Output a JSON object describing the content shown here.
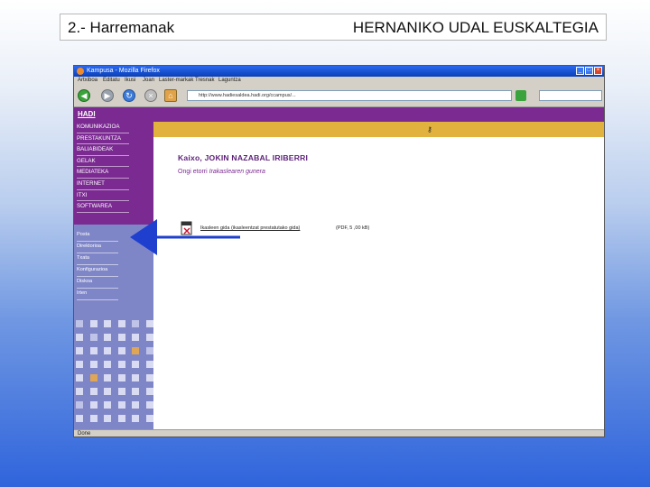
{
  "slide": {
    "title_left": "2.- Harremanak",
    "title_right": "HERNANIKO UDAL EUSKALTEGIA"
  },
  "browser": {
    "window_title": "Kampusa - Mozilla Firefox",
    "menu": [
      "Artxiboa",
      "Editatu",
      "Ikusi",
      "Joan",
      "Laster-markak",
      "Tresnak",
      "Laguntza"
    ],
    "url": "http://www.hadiesaldea.hadi.org/ccampus/...",
    "search_value": "",
    "status": "Done"
  },
  "sidebar": {
    "logo": "HADI",
    "menu": [
      "KOMUNIKAZIOA",
      "PRESTAKUNTZA",
      "BALIABIDEAK",
      "GELAK",
      "MEDIATEKA",
      "INTERNET",
      "ITXI",
      "SOFTWAREA"
    ],
    "submenu": [
      "Posta",
      "Direktorioa",
      "Txata",
      "Konfigurazioa",
      "Diskoa",
      "Irten"
    ],
    "squares": [
      "#bfc3e8",
      "#d9dbf2",
      "#d9dbf2",
      "#d9dbf2",
      "#bfc3e8",
      "#d9dbf2",
      "#d9dbf2",
      "#bfc3e8",
      "#d9dbf2",
      "#d9dbf2",
      "#d9dbf2",
      "#d9dbf2",
      "#d9dbf2",
      "#d9dbf2",
      "#d9dbf2",
      "#d9dbf2",
      "#e0a657",
      "#bfc3e8",
      "#d9dbf2",
      "#d9dbf2",
      "#d9dbf2",
      "#d9dbf2",
      "#d9dbf2",
      "#d9dbf2",
      "#d9dbf2",
      "#e0a657",
      "#d9dbf2",
      "#d9dbf2",
      "#d9dbf2",
      "#d9dbf2",
      "#d9dbf2",
      "#d9dbf2",
      "#d9dbf2",
      "#d9dbf2",
      "#d9dbf2",
      "#d9dbf2",
      "#bfc3e8",
      "#d9dbf2",
      "#d9dbf2",
      "#d9dbf2",
      "#d9dbf2",
      "#d9dbf2",
      "#d9dbf2",
      "#d9dbf2",
      "#d9dbf2",
      "#d9dbf2",
      "#d9dbf2",
      "#d9dbf2"
    ]
  },
  "content": {
    "greeting": "Kaixo, JOKIN NAZABAL IRIBERRI",
    "welcome_prefix": "Ongi etorri ",
    "welcome_em": "Irakaslearen gunera",
    "doc_link": "Ikasleen gida (ikasleentzat prestatutako gida)",
    "doc_size": "(PDF, 5 ,00 kB)"
  },
  "colors": {
    "purple": "#7a2a91",
    "gold": "#e1b23d",
    "lavender": "#7f86c8",
    "arrow": "#1f3fcf"
  }
}
